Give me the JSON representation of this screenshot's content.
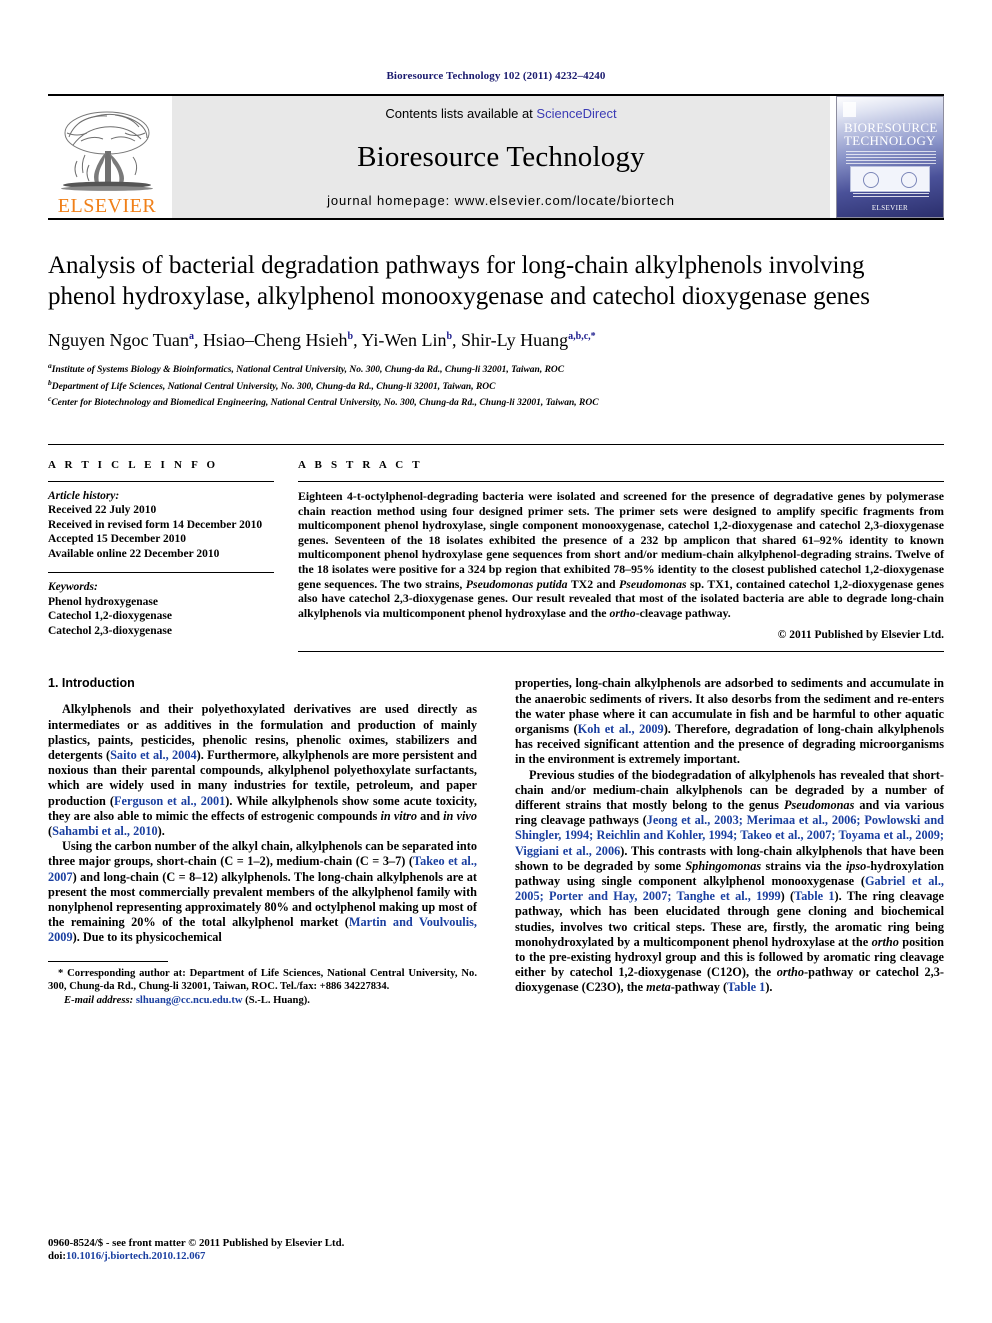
{
  "running_head": "Bioresource Technology 102 (2011) 4232–4240",
  "masthead": {
    "publisher_name": "ELSEVIER",
    "contents_prefix": "Contents lists available at ",
    "sciencedirect": "ScienceDirect",
    "journal_name": "Bioresource Technology",
    "homepage": "journal homepage: www.elsevier.com/locate/biortech",
    "cover": {
      "title_line1": "BIORESOURCE",
      "title_line2": "TECHNOLOGY",
      "publisher_mark": "ELSEVIER"
    }
  },
  "article": {
    "title": "Analysis of bacterial degradation pathways for long-chain alkylphenols involving phenol hydroxylase, alkylphenol monooxygenase and catechol dioxygenase genes",
    "authors": [
      {
        "name": "Nguyen Ngoc Tuan",
        "sup": "a"
      },
      {
        "name": "Hsiao–Cheng Hsieh",
        "sup": "b"
      },
      {
        "name": "Yi-Wen Lin",
        "sup": "b"
      },
      {
        "name": "Shir-Ly Huang",
        "sup": "a,b,c,*"
      }
    ],
    "affiliations": [
      {
        "sup": "a",
        "text": "Institute of Systems Biology & Bioinformatics, National Central University, No. 300, Chung-da Rd., Chung-li 32001, Taiwan, ROC"
      },
      {
        "sup": "b",
        "text": "Department of Life Sciences, National Central University, No. 300, Chung-da Rd., Chung-li 32001, Taiwan, ROC"
      },
      {
        "sup": "c",
        "text": "Center for Biotechnology and Biomedical Engineering, National Central University, No. 300, Chung-da Rd., Chung-li 32001, Taiwan, ROC"
      }
    ]
  },
  "article_info": {
    "heading": "A R T I C L E    I N F O",
    "history_label": "Article history:",
    "history": [
      "Received 22 July 2010",
      "Received in revised form 14 December 2010",
      "Accepted 15 December 2010",
      "Available online 22 December 2010"
    ],
    "keywords_label": "Keywords:",
    "keywords": [
      "Phenol hydroxygenase",
      "Catechol 1,2-dioxygenase",
      "Catechol 2,3-dioxygenase"
    ]
  },
  "abstract": {
    "heading": "A B S T R A C T",
    "paragraph_1": "Eighteen 4-t-octylphenol-degrading bacteria were isolated and screened for the presence of degradative genes by polymerase chain reaction method using four designed primer sets. The primer sets were designed to amplify specific fragments from multicomponent phenol hydroxylase, single component monooxygenase, catechol 1,2-dioxygenase and catechol 2,3-dioxygenase genes. Seventeen of the 18 isolates exhibited the presence of a 232 bp amplicon that shared 61–92% identity to known multicomponent phenol hydroxylase gene sequences from short and/or medium-chain alkylphenol-degrading strains. Twelve of the 18 isolates were positive for a 324 bp region that exhibited 78–95% identity to the closest published catechol 1,2-dioxygenase gene sequences. The two strains, ",
    "italic_1": "Pseudomonas putida",
    "paragraph_2": " TX2 and ",
    "italic_2": "Pseudomonas",
    "paragraph_3": " sp. TX1, contained catechol 1,2-dioxygenase genes also have catechol 2,3-dioxygenase genes. Our result revealed that most of the isolated bacteria are able to degrade long-chain alkylphenols via multicomponent phenol hydroxylase and the ",
    "italic_3": "ortho",
    "paragraph_4": "-cleavage pathway.",
    "copyright": "© 2011 Published by Elsevier Ltd."
  },
  "introduction": {
    "heading": "1. Introduction",
    "left_paragraphs": [
      {
        "parts": [
          {
            "t": "Alkylphenols and their polyethoxylated derivatives are used directly as intermediates or as additives in the formulation and production of mainly plastics, paints, pesticides, phenolic resins, phenolic oximes, stabilizers and detergents ("
          },
          {
            "t": "Saito et al., 2004",
            "k": "cite"
          },
          {
            "t": "). Furthermore, alkylphenols are more persistent and noxious than their parental compounds, alkylphenol polyethoxylate surfactants, which are widely used in many industries for textile, petroleum, and paper production ("
          },
          {
            "t": "Ferguson et al., 2001",
            "k": "cite"
          },
          {
            "t": "). While alkylphenols show some acute toxicity, they are also able to mimic the effects of estrogenic compounds "
          },
          {
            "t": "in vitro",
            "k": "ital"
          },
          {
            "t": " and "
          },
          {
            "t": "in vivo",
            "k": "ital"
          },
          {
            "t": " ("
          },
          {
            "t": "Sahambi et al., 2010",
            "k": "cite"
          },
          {
            "t": ")."
          }
        ]
      },
      {
        "parts": [
          {
            "t": "Using the carbon number of the alkyl chain, alkylphenols can be separated into three major groups, short-chain (C = 1–2), medium-chain (C = 3–7) ("
          },
          {
            "t": "Takeo et al., 2007",
            "k": "cite"
          },
          {
            "t": ") and long-chain (C = 8–12) alkylphenols. The long-chain alkylphenols are at present the most commercially prevalent members of the alkylphenol family with nonylphenol representing approximately 80% and octylphenol making up most of the remaining 20% of the total alkylphenol market ("
          },
          {
            "t": "Martin and Voulvoulis, 2009",
            "k": "cite"
          },
          {
            "t": "). Due to its physicochemical"
          }
        ]
      }
    ],
    "right_paragraphs": [
      {
        "parts": [
          {
            "t": "properties, long-chain alkylphenols are adsorbed to sediments and accumulate in the anaerobic sediments of rivers. It also desorbs from the sediment and re-enters the water phase where it can accumulate in fish and be harmful to other aquatic organisms ("
          },
          {
            "t": "Koh et al., 2009",
            "k": "cite"
          },
          {
            "t": "). Therefore, degradation of long-chain alkylphenols has received significant attention and the presence of degrading microorganisms in the environment is extremely important."
          }
        ]
      },
      {
        "parts": [
          {
            "t": "Previous studies of the biodegradation of alkylphenols has revealed that short-chain and/or medium-chain alkylphenols can be degraded by a number of different strains that mostly belong to the genus "
          },
          {
            "t": "Pseudomonas",
            "k": "ital"
          },
          {
            "t": " and via various ring cleavage pathways ("
          },
          {
            "t": "Jeong et al., 2003; Merimaa et al., 2006; Powlowski and Shingler, 1994; Reichlin and Kohler, 1994; Takeo et al., 2007; Toyama et al., 2009; Viggiani et al., 2006",
            "k": "cite"
          },
          {
            "t": "). This contrasts with long-chain alkylphenols that have been shown to be degraded by some "
          },
          {
            "t": "Sphingomonas",
            "k": "ital"
          },
          {
            "t": " strains via the "
          },
          {
            "t": "ipso",
            "k": "ital"
          },
          {
            "t": "-hydroxylation pathway using single component alkylphenol monooxygenase ("
          },
          {
            "t": "Gabriel et al., 2005; Porter and Hay, 2007; Tanghe et al., 1999",
            "k": "cite"
          },
          {
            "t": ") ("
          },
          {
            "t": "Table 1",
            "k": "cite"
          },
          {
            "t": "). The ring cleavage pathway, which has been elucidated through gene cloning and biochemical studies, involves two critical steps. These are, firstly, the aromatic ring being monohydroxylated by a multicomponent phenol hydroxylase at the "
          },
          {
            "t": "ortho",
            "k": "ital"
          },
          {
            "t": " position to the pre-existing hydroxyl group and this is followed by aromatic ring cleavage either by catechol 1,2-dioxygenase (C12O), the "
          },
          {
            "t": "ortho",
            "k": "ital"
          },
          {
            "t": "-pathway or catechol 2,3-dioxygenase (C23O), the "
          },
          {
            "t": "meta",
            "k": "ital"
          },
          {
            "t": "-pathway ("
          },
          {
            "t": "Table 1",
            "k": "cite"
          },
          {
            "t": ")."
          }
        ]
      }
    ]
  },
  "footnote": {
    "corresponding": "* Corresponding author at: Department of Life Sciences, National Central University, No. 300, Chung-da Rd., Chung-li 32001, Taiwan, ROC. Tel./fax: +886 34227834.",
    "email_label": "E-mail address:",
    "email": "slhuang@cc.ncu.edu.tw",
    "email_owner": "(S.-L. Huang)."
  },
  "footer": {
    "issn_line": "0960-8524/$ - see front matter © 2011 Published by Elsevier Ltd.",
    "doi_label": "doi:",
    "doi": "10.1016/j.biortech.2010.12.067"
  },
  "colors": {
    "link_blue": "#1a3fa0",
    "header_navy": "#1a1a6e",
    "elsevier_orange": "#F08019"
  }
}
